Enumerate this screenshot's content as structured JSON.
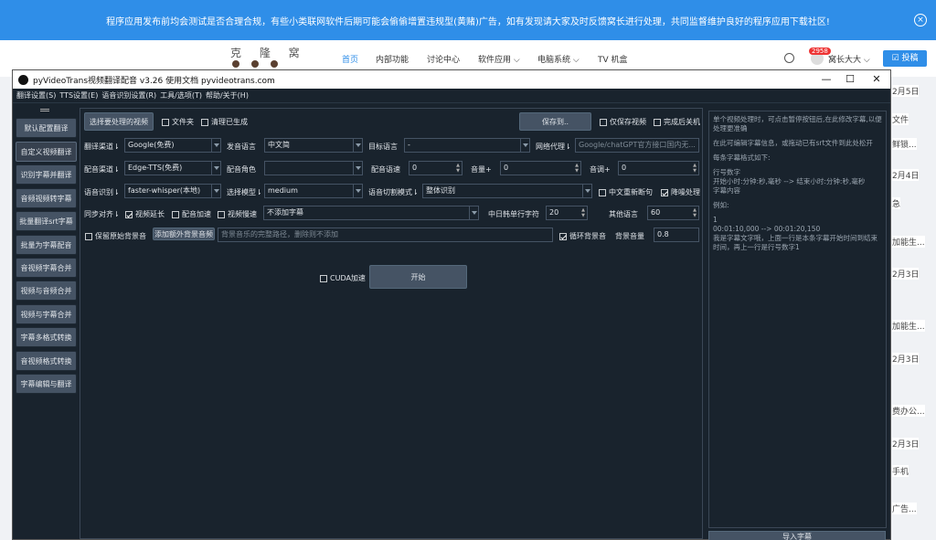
{
  "banner": {
    "text": "程序应用发布前均会测试是否合理合规，有些小类联网软件后期可能会偷偷增置违规型(黄赌)广告，如有发现请大家及时反馈窝长进行处理，共同监督维护良好的程序应用下载社区!",
    "close": "×"
  },
  "site": {
    "logo": "克 隆 窝",
    "nav": [
      "首页",
      "内部功能",
      "讨论中心",
      "软件应用 ⌵",
      "电脑系统 ⌵",
      "TV 机盒"
    ],
    "badge": "2958",
    "user": "窝长大大 ⌵",
    "post_button": "☑ 投稿",
    "right_snippets": [
      "2月5日",
      "文件",
      "鲜锁...",
      "2月4日",
      "急",
      "加能生...",
      "2月3日",
      "加能生...",
      "2月3日",
      "费办公...",
      "2月3日",
      "手机",
      "广告..."
    ]
  },
  "window": {
    "title": "pyVideoTrans视频翻译配音 v3.26  使用文档  pyvideotrans.com",
    "controls": {
      "min": "—",
      "max": "☐",
      "close": "✕"
    },
    "menu": [
      "翻译设置(S)",
      "TTS设置(E)",
      "语音识别设置(R)",
      "工具/选项(T)",
      "帮助/关于(H)"
    ]
  },
  "sidebar": [
    "默认配置翻译",
    "自定义视频翻译",
    "识别字幕并翻译",
    "音频视频转字幕",
    "批量翻译srt字幕",
    "批量为字幕配音",
    "音视频字幕合并",
    "视频与音频合并",
    "视频与字幕合并",
    "字幕多格式转换",
    "音视频格式转换",
    "字幕编辑与翻译"
  ],
  "row1": {
    "select_video": "选择要处理的视频",
    "folder": "文件夹",
    "clean": "清理已生成",
    "save_to": "保存到..",
    "only_video": "仅保存视频",
    "shutdown": "完成后关机"
  },
  "row2": {
    "channel_label": "翻译渠道⇂",
    "channel": "Google(免费)",
    "src_lang_label": "发音语言",
    "src_lang": "中文简",
    "tgt_lang_label": "目标语言",
    "tgt_lang": "-",
    "proxy_label": "网络代理⇂",
    "proxy_placeholder": "Google/chatGPT官方接口国内无..."
  },
  "row3": {
    "tts_label": "配音渠道⇂",
    "tts": "Edge-TTS(免费)",
    "role_label": "配音角色",
    "role": "",
    "rate_label": "配音语速",
    "rate": "0",
    "volume_label": "音量+",
    "volume": "0",
    "pitch_label": "音调+",
    "pitch": "0"
  },
  "row4": {
    "asr_label": "语音识别⇂",
    "asr": "faster-whisper(本地)",
    "model_label": "选择模型⇂",
    "model": "medium",
    "split_label": "语音切割模式⇂",
    "split": "整体识别",
    "rebreak": "中文重新断句",
    "denoise": "降噪处理"
  },
  "row5": {
    "sync_label": "同步对齐⇂",
    "video_extend": "视频延长",
    "voice_speed": "配音加速",
    "video_slow": "视频慢速",
    "subtitle": "不添加字幕",
    "cjk_label": "中日韩单行字符",
    "cjk": "20",
    "other_label": "其他语言",
    "other": "60"
  },
  "row6": {
    "keep_bg": "保留原始背景音",
    "add_bg": "添加额外背景音频",
    "bg_placeholder": "背景音乐的完整路径，删除则不添加",
    "loop_bg": "循环背景音",
    "bg_vol_label": "背景音量",
    "bg_vol": "0.8"
  },
  "row7": {
    "cuda": "CUDA加速",
    "start": "开始"
  },
  "right_pane": {
    "lines": [
      "单个视频处理时，可点击暂停按钮后,在此修改字幕,以便处理更准确",
      "在此可编辑字幕信息，或拖动已有srt文件到此处松开",
      "每条字幕格式如下:",
      "行号数字\n开始小时:分钟:秒,毫秒 --> 结束小时:分钟:秒,毫秒\n字幕内容",
      "例如:",
      "1\n00:01:10,000 --> 00:01:20,150\n我是字幕文字哦，上面一行是本条字幕开始时间到结束时间，再上一行是行号数字1"
    ],
    "import": "导入字幕"
  }
}
